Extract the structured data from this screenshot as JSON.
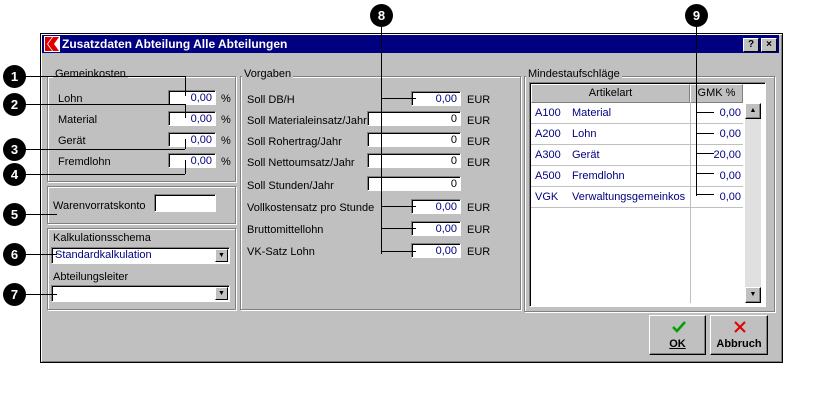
{
  "window": {
    "title": "Zusatzdaten Abteilung Alle Abteilungen",
    "help_label": "?",
    "close_label": "×"
  },
  "gemeinkosten": {
    "title": "Gemeinkosten",
    "rows": [
      {
        "label": "Lohn",
        "value": "0,00",
        "unit": "%"
      },
      {
        "label": "Material",
        "value": "0,00",
        "unit": "%"
      },
      {
        "label": "Gerät",
        "value": "0,00",
        "unit": "%"
      },
      {
        "label": "Fremdlohn",
        "value": "0,00",
        "unit": "%"
      }
    ]
  },
  "warenvorrat": {
    "label": "Warenvorratskonto",
    "value": ""
  },
  "kalkulation": {
    "label": "Kalkulationsschema",
    "value": "Standardkalkulation"
  },
  "abteilungsleiter": {
    "label": "Abteilungsleiter",
    "value": ""
  },
  "vorgaben": {
    "title": "Vorgaben",
    "rows": [
      {
        "label": "Soll DB/H",
        "value": "0,00",
        "unit": "EUR"
      },
      {
        "label": "Soll Materialeinsatz/Jahr",
        "value": "0",
        "unit": "EUR"
      },
      {
        "label": "Soll Rohertrag/Jahr",
        "value": "0",
        "unit": "EUR"
      },
      {
        "label": "Soll Nettoumsatz/Jahr",
        "value": "0",
        "unit": "EUR"
      },
      {
        "label": "Soll Stunden/Jahr",
        "value": "0",
        "unit": ""
      },
      {
        "label": "Vollkostensatz pro Stunde",
        "value": "0,00",
        "unit": "EUR"
      },
      {
        "label": "Bruttomittellohn",
        "value": "0,00",
        "unit": "EUR"
      },
      {
        "label": "VK-Satz Lohn",
        "value": "0,00",
        "unit": "EUR"
      }
    ]
  },
  "mindestaufschlaege": {
    "title": "Mindestaufschläge",
    "headers": [
      "Artikelart",
      "GMK %"
    ],
    "rows": [
      {
        "code": "A100",
        "name": "Material",
        "gmk": "0,00"
      },
      {
        "code": "A200",
        "name": "Lohn",
        "gmk": "0,00"
      },
      {
        "code": "A300",
        "name": "Gerät",
        "gmk": "20,00"
      },
      {
        "code": "A500",
        "name": "Fremdlohn",
        "gmk": "0,00"
      },
      {
        "code": "VGK",
        "name": "Verwaltungsgemeinkos",
        "gmk": "0,00"
      }
    ]
  },
  "buttons": {
    "ok": "OK",
    "abbruch": "Abbruch"
  },
  "callouts": [
    "1",
    "2",
    "3",
    "4",
    "5",
    "6",
    "7",
    "8",
    "9"
  ],
  "colors": {
    "titlebar": "#000080",
    "value_text": "#000080",
    "ok_check": "#00a000",
    "abbruch_x": "#e00000"
  }
}
